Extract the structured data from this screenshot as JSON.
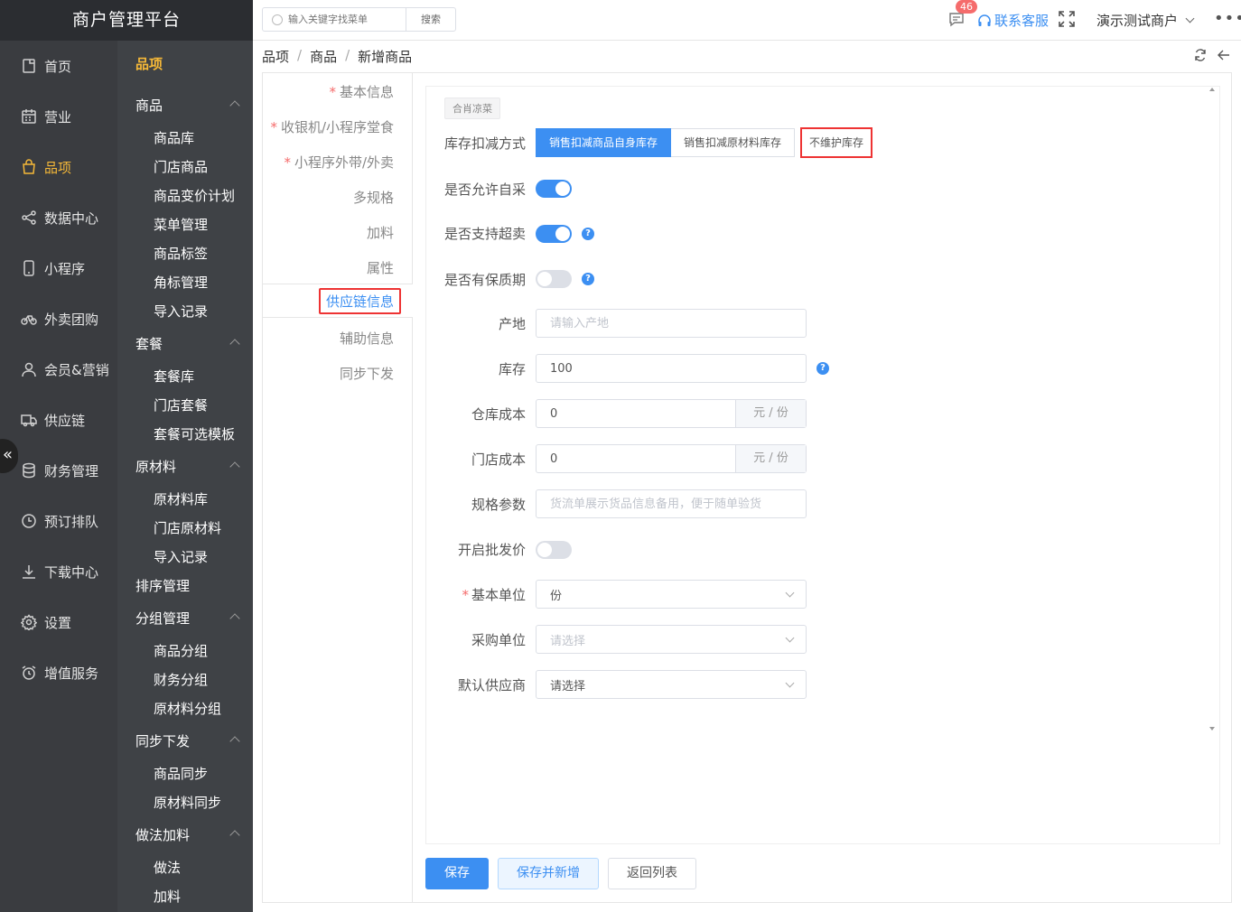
{
  "app": {
    "title": "商户管理平台"
  },
  "sidebar": {
    "items": [
      {
        "label": "首页",
        "icon": "document-icon"
      },
      {
        "label": "营业",
        "icon": "calendar-icon"
      },
      {
        "label": "品项",
        "icon": "bag-icon"
      },
      {
        "label": "数据中心",
        "icon": "share-icon"
      },
      {
        "label": "小程序",
        "icon": "phone-icon"
      },
      {
        "label": "外卖团购",
        "icon": "bike-icon"
      },
      {
        "label": "会员&营销",
        "icon": "user-icon"
      },
      {
        "label": "供应链",
        "icon": "truck-icon"
      },
      {
        "label": "财务管理",
        "icon": "coins-icon"
      },
      {
        "label": "预订排队",
        "icon": "clock-icon"
      },
      {
        "label": "下载中心",
        "icon": "download-icon"
      },
      {
        "label": "设置",
        "icon": "gear-icon"
      },
      {
        "label": "增值服务",
        "icon": "alarm-icon"
      }
    ],
    "active": "品项",
    "collapse_glyph": "«"
  },
  "submenu": {
    "title": "品项",
    "groups": [
      {
        "label": "商品",
        "items": [
          "商品库",
          "门店商品",
          "商品变价计划",
          "菜单管理",
          "商品标签",
          "角标管理",
          "导入记录"
        ]
      },
      {
        "label": "套餐",
        "items": [
          "套餐库",
          "门店套餐",
          "套餐可选模板"
        ]
      },
      {
        "label": "原材料",
        "items": [
          "原材料库",
          "门店原材料",
          "导入记录"
        ]
      },
      {
        "label": "排序管理",
        "items": []
      },
      {
        "label": "分组管理",
        "items": [
          "商品分组",
          "财务分组",
          "原材料分组"
        ]
      },
      {
        "label": "同步下发",
        "items": [
          "商品同步",
          "原材料同步"
        ]
      },
      {
        "label": "做法加料",
        "items": [
          "做法",
          "加料"
        ]
      }
    ]
  },
  "header": {
    "search_placeholder": "输入关键字找菜单",
    "search_button": "搜索",
    "message_count": "46",
    "support_label": "联系客服",
    "merchant_name": "演示测试商户",
    "more_glyph": "•••"
  },
  "breadcrumb": [
    "品项",
    "商品",
    "新增商品"
  ],
  "tabs": [
    {
      "label": "基本信息",
      "required": true
    },
    {
      "label": "收银机/小程序堂食",
      "required": true
    },
    {
      "label": "小程序外带/外卖",
      "required": true
    },
    {
      "label": "多规格",
      "required": false
    },
    {
      "label": "加料",
      "required": false
    },
    {
      "label": "属性",
      "required": false
    },
    {
      "label": "供应链信息",
      "required": false
    },
    {
      "label": "辅助信息",
      "required": false
    },
    {
      "label": "同步下发",
      "required": false
    }
  ],
  "active_tab": "供应链信息",
  "form": {
    "tag": "合肖凉菜",
    "stock_mode": {
      "label": "库存扣减方式",
      "options": [
        "销售扣减商品自身库存",
        "销售扣减原材料库存",
        "不维护库存"
      ],
      "selected": "销售扣减商品自身库存"
    },
    "allow_self_purchase": {
      "label": "是否允许自采",
      "on": true
    },
    "allow_oversell": {
      "label": "是否支持超卖",
      "on": true
    },
    "has_shelf_life": {
      "label": "是否有保质期",
      "on": false
    },
    "origin": {
      "label": "产地",
      "placeholder": "请输入产地",
      "value": ""
    },
    "stock": {
      "label": "库存",
      "value": "100"
    },
    "warehouse_cost": {
      "label": "仓库成本",
      "value": "0",
      "suffix": "元 / 份"
    },
    "store_cost": {
      "label": "门店成本",
      "value": "0",
      "suffix": "元 / 份"
    },
    "spec_params": {
      "label": "规格参数",
      "placeholder": "货流单展示货品信息备用，便于随单验货",
      "value": ""
    },
    "wholesale_price": {
      "label": "开启批发价",
      "on": false
    },
    "base_unit": {
      "label": "基本单位",
      "value": "份",
      "required": true
    },
    "purchase_unit": {
      "label": "采购单位",
      "placeholder": "请选择"
    },
    "default_supplier": {
      "label": "默认供应商",
      "value": "请选择"
    },
    "help_glyph": "?",
    "required_mark": "*"
  },
  "buttons": {
    "save": "保存",
    "save_new": "保存并新增",
    "back_list": "返回列表"
  }
}
